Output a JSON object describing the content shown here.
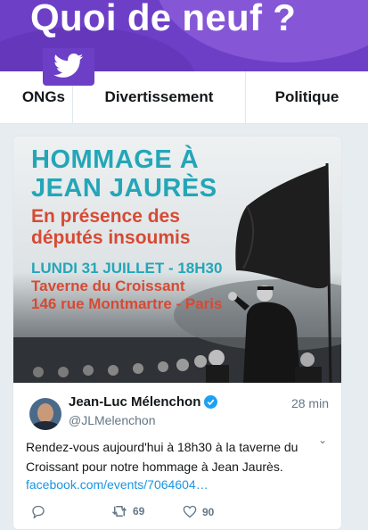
{
  "header": {
    "title": "Quoi de neuf ?",
    "brand_color": "#6d3fc7",
    "bird_icon": "twitter-bird-icon"
  },
  "categories": [
    {
      "label": "ONGs"
    },
    {
      "label": "Divertissement"
    },
    {
      "label": "Politique"
    }
  ],
  "tweet": {
    "image": {
      "title_line1": "HOMMAGE À",
      "title_line2": "JEAN JAURÈS",
      "subtitle_line1": "En présence des",
      "subtitle_line2": "députés insoumis",
      "date_line": "LUNDI 31 JUILLET - 18H30",
      "place_line1": "Taverne du Croissant",
      "place_line2": "146 rue Montmartre - Paris",
      "accent_teal": "#23a6b8",
      "accent_red": "#d64a34"
    },
    "author_name": "Jean-Luc Mélenchon",
    "author_handle": "@JLMelenchon",
    "time": "28 min",
    "text_line1": "Rendez-vous aujourd'hui à 18h30 à la taverne du",
    "text_line2": "Croissant pour notre hommage à Jean Jaurès.",
    "link": "facebook.com/events/7064604…",
    "retweets": "69",
    "likes": "90"
  }
}
